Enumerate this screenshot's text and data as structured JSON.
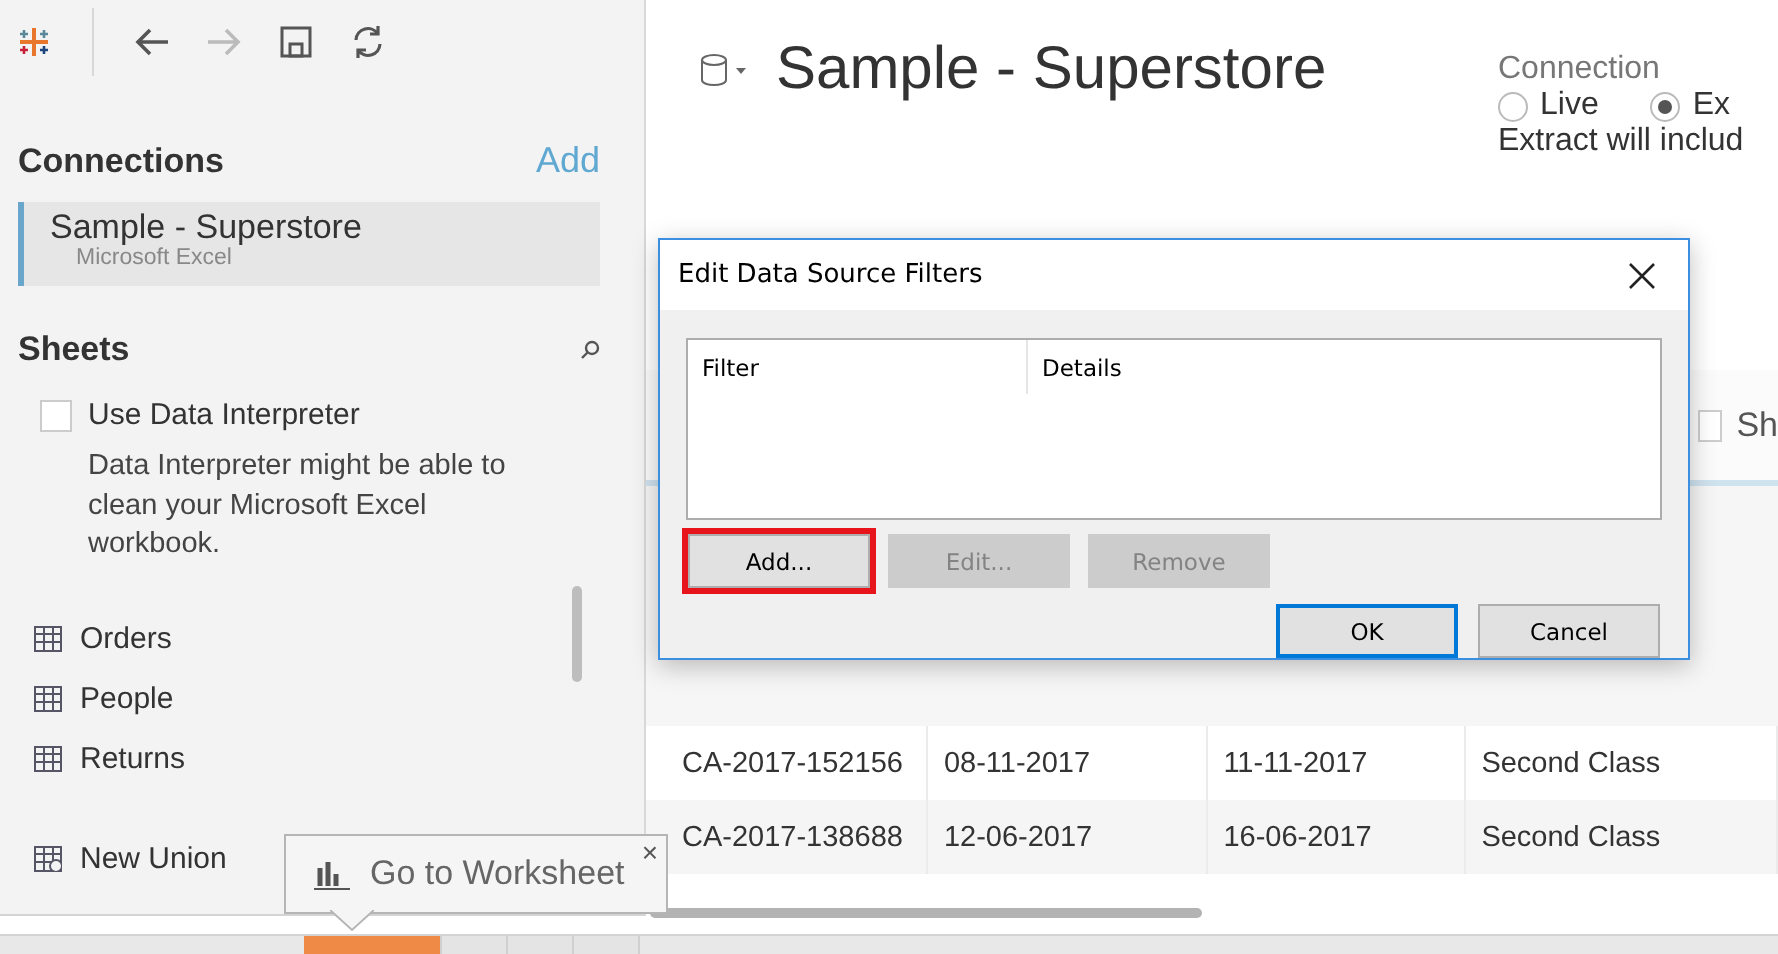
{
  "toolbar": {
    "buttons": [
      {
        "kind": "back",
        "disabled": false
      },
      {
        "kind": "forward",
        "disabled": true
      },
      {
        "kind": "save",
        "disabled": false
      },
      {
        "kind": "refresh",
        "disabled": false
      }
    ]
  },
  "sidebar": {
    "connections_title": "Connections",
    "add_link": "Add",
    "connections": [
      {
        "name": "Sample - Superstore",
        "type": "Microsoft Excel",
        "selected": true
      }
    ],
    "sheets_title": "Sheets",
    "interpreter": {
      "label": "Use Data Interpreter",
      "checked": false,
      "description": "Data Interpreter might be able to clean your Microsoft Excel workbook."
    },
    "sheets": [
      {
        "kind": "table",
        "name": "Orders"
      },
      {
        "kind": "table",
        "name": "People"
      },
      {
        "kind": "table",
        "name": "Returns"
      },
      {
        "kind": "union",
        "name": "New Union"
      }
    ]
  },
  "main": {
    "title": "Sample - Superstore",
    "connection": {
      "label": "Connection",
      "options": [
        {
          "label": "Live",
          "selected": false
        },
        {
          "label": "Ex",
          "selected": true
        }
      ],
      "note": "Extract will includ"
    },
    "show_checkbox": {
      "label": "Sh",
      "checked": false
    },
    "rows": [
      [
        "CA-2017-152156",
        "08-11-2017",
        "11-11-2017",
        "Second Class"
      ],
      [
        "CA-2017-138688",
        "12-06-2017",
        "16-06-2017",
        "Second Class"
      ]
    ]
  },
  "dialog": {
    "title": "Edit Data Source Filters",
    "columns": [
      "Filter",
      "Details"
    ],
    "buttons": [
      {
        "label": "Add...",
        "disabled": false,
        "highlighted": true
      },
      {
        "label": "Edit...",
        "disabled": true,
        "highlighted": false
      },
      {
        "label": "Remove",
        "disabled": true,
        "highlighted": false
      }
    ],
    "actions": [
      {
        "label": "OK",
        "default": true
      },
      {
        "label": "Cancel",
        "default": false
      }
    ]
  },
  "tooltip": {
    "text": "Go to Worksheet",
    "close": "×"
  },
  "sheet_tabs": [
    {
      "selected": true
    },
    {
      "selected": false
    },
    {
      "selected": false
    },
    {
      "selected": false
    }
  ]
}
